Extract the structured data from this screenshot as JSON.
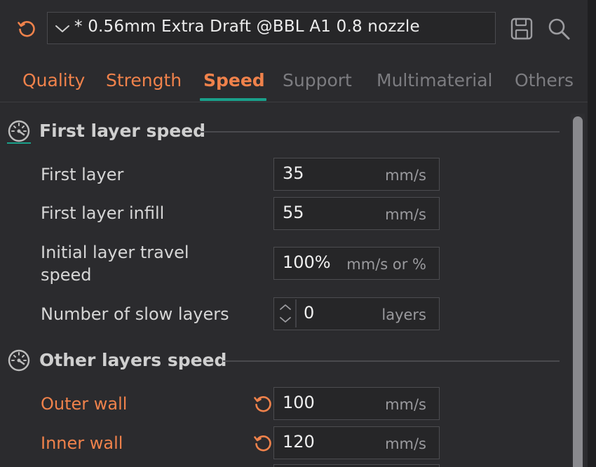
{
  "preset": {
    "name": "* 0.56mm Extra Draft @BBL A1 0.8 nozzle"
  },
  "tabs": [
    {
      "label": "Quality",
      "state": "modified"
    },
    {
      "label": "Strength",
      "state": "modified"
    },
    {
      "label": "Speed",
      "state": "active"
    },
    {
      "label": "Support",
      "state": "normal"
    },
    {
      "label": "Multimaterial",
      "state": "normal"
    },
    {
      "label": "Others",
      "state": "normal"
    }
  ],
  "sections": [
    {
      "title": "First layer speed",
      "icon": "speedometer-icon",
      "rows": [
        {
          "label": "First layer",
          "value": "35",
          "unit": "mm/s"
        },
        {
          "label": "First layer infill",
          "value": "55",
          "unit": "mm/s"
        },
        {
          "label_line1": "Initial layer travel",
          "label_line2": "speed",
          "value": "100%",
          "unit": "mm/s or %"
        },
        {
          "label": "Number of slow layers",
          "value": "0",
          "unit": "layers"
        }
      ]
    },
    {
      "title": "Other layers speed",
      "icon": "speedometer-icon",
      "rows": [
        {
          "label": "Outer wall",
          "value": "100",
          "unit": "mm/s",
          "modified": true
        },
        {
          "label": "Inner wall",
          "value": "120",
          "unit": "mm/s",
          "modified": true
        }
      ]
    }
  ],
  "colors": {
    "accent_orange": "#f0824b",
    "accent_teal": "#1aa08a",
    "background": "#2b2b2e",
    "dim_text": "#7c7c80"
  }
}
